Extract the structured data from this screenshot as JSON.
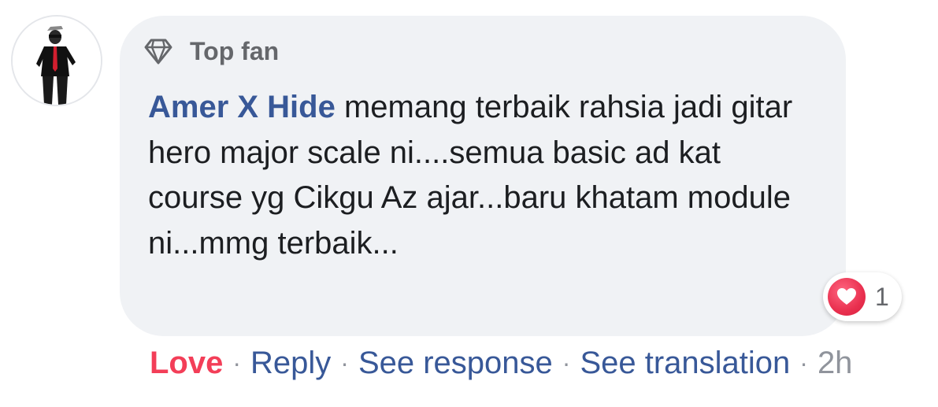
{
  "badge": {
    "icon": "diamond-icon",
    "label": "Top fan"
  },
  "comment": {
    "author": "Amer X Hide",
    "text": "memang terbaik rahsia jadi gitar hero major scale ni....semua basic ad kat course yg Cikgu Az ajar...baru khatam module ni...mmg terbaik..."
  },
  "reaction": {
    "icon": "heart-icon",
    "count": "1"
  },
  "actions": {
    "love_label": "Love",
    "reply_label": "Reply",
    "see_response_label": "See response",
    "see_translation_label": "See translation",
    "separator": "·",
    "time": "2h"
  },
  "colors": {
    "bubble_bg": "#f0f2f5",
    "author_link": "#385898",
    "love": "#f33e58",
    "meta_gray": "#90949c",
    "badge_gray": "#65676b"
  }
}
